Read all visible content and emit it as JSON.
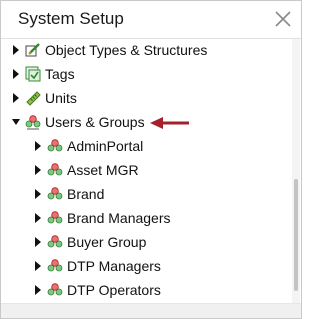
{
  "panel": {
    "title": "System Setup",
    "close_icon": "close-icon"
  },
  "tree": {
    "top_items": [
      {
        "label": "Object Types & Structures",
        "icon": "object-types-icon",
        "expanded": false
      },
      {
        "label": "Tags",
        "icon": "tags-icon",
        "expanded": false
      },
      {
        "label": "Units",
        "icon": "units-ruler-icon",
        "expanded": false
      },
      {
        "label": "Users & Groups",
        "icon": "users-groups-icon",
        "expanded": true
      }
    ],
    "groups": [
      {
        "label": "AdminPortal",
        "icon": "group-icon"
      },
      {
        "label": "Asset MGR",
        "icon": "group-icon"
      },
      {
        "label": "Brand",
        "icon": "group-icon"
      },
      {
        "label": "Brand Managers",
        "icon": "group-icon"
      },
      {
        "label": "Buyer Group",
        "icon": "group-icon"
      },
      {
        "label": "DTP Managers",
        "icon": "group-icon"
      },
      {
        "label": "DTP Operators",
        "icon": "group-icon"
      }
    ]
  },
  "colors": {
    "highlight_arrow": "#a3212b",
    "caret": "#111111",
    "users_icon_red": "#d9534f",
    "users_icon_green": "#3a9a3a"
  }
}
